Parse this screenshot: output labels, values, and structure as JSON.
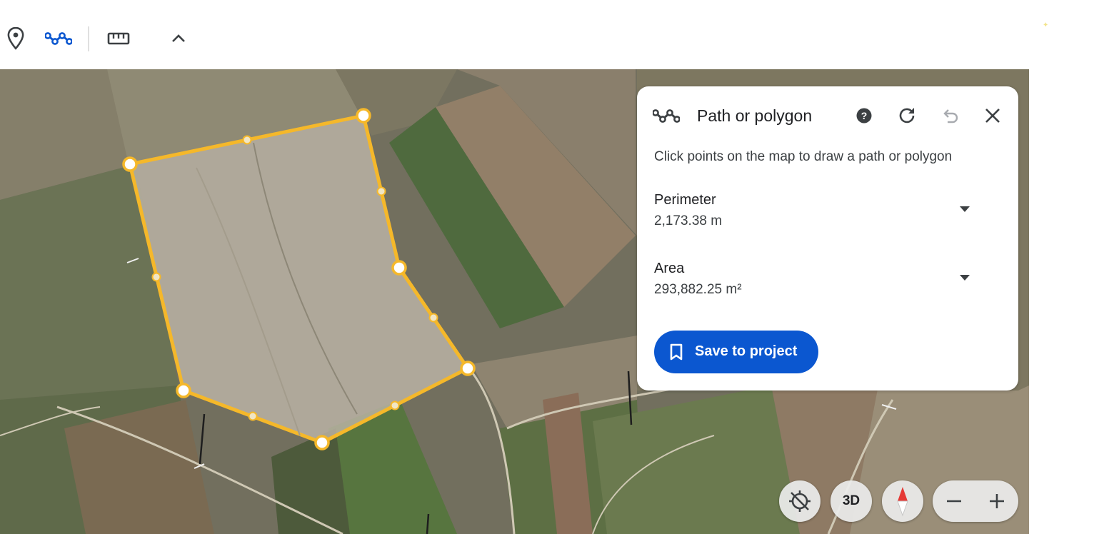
{
  "toolbar": {
    "icons": [
      "place-marker-icon",
      "path-polygon-icon",
      "ruler-icon",
      "chevron-up-icon"
    ],
    "accent_color": "#0b57d0"
  },
  "panel": {
    "title": "Path or polygon",
    "instruction": "Click points on the map to draw a path or polygon",
    "perimeter": {
      "label": "Perimeter",
      "value": "2,173.38 m"
    },
    "area": {
      "label": "Area",
      "value": "293,882.25 m²"
    },
    "save_label": "Save to project",
    "icons": [
      "help-icon",
      "refresh-icon",
      "undo-icon",
      "close-icon"
    ]
  },
  "map_controls": {
    "view_3d_label": "3D",
    "icons": [
      "rotation-lock-icon",
      "compass-icon",
      "zoom-out-icon",
      "zoom-in-icon"
    ]
  },
  "colors": {
    "polygon_stroke": "#f5b82a",
    "save_button": "#0b57d0"
  }
}
